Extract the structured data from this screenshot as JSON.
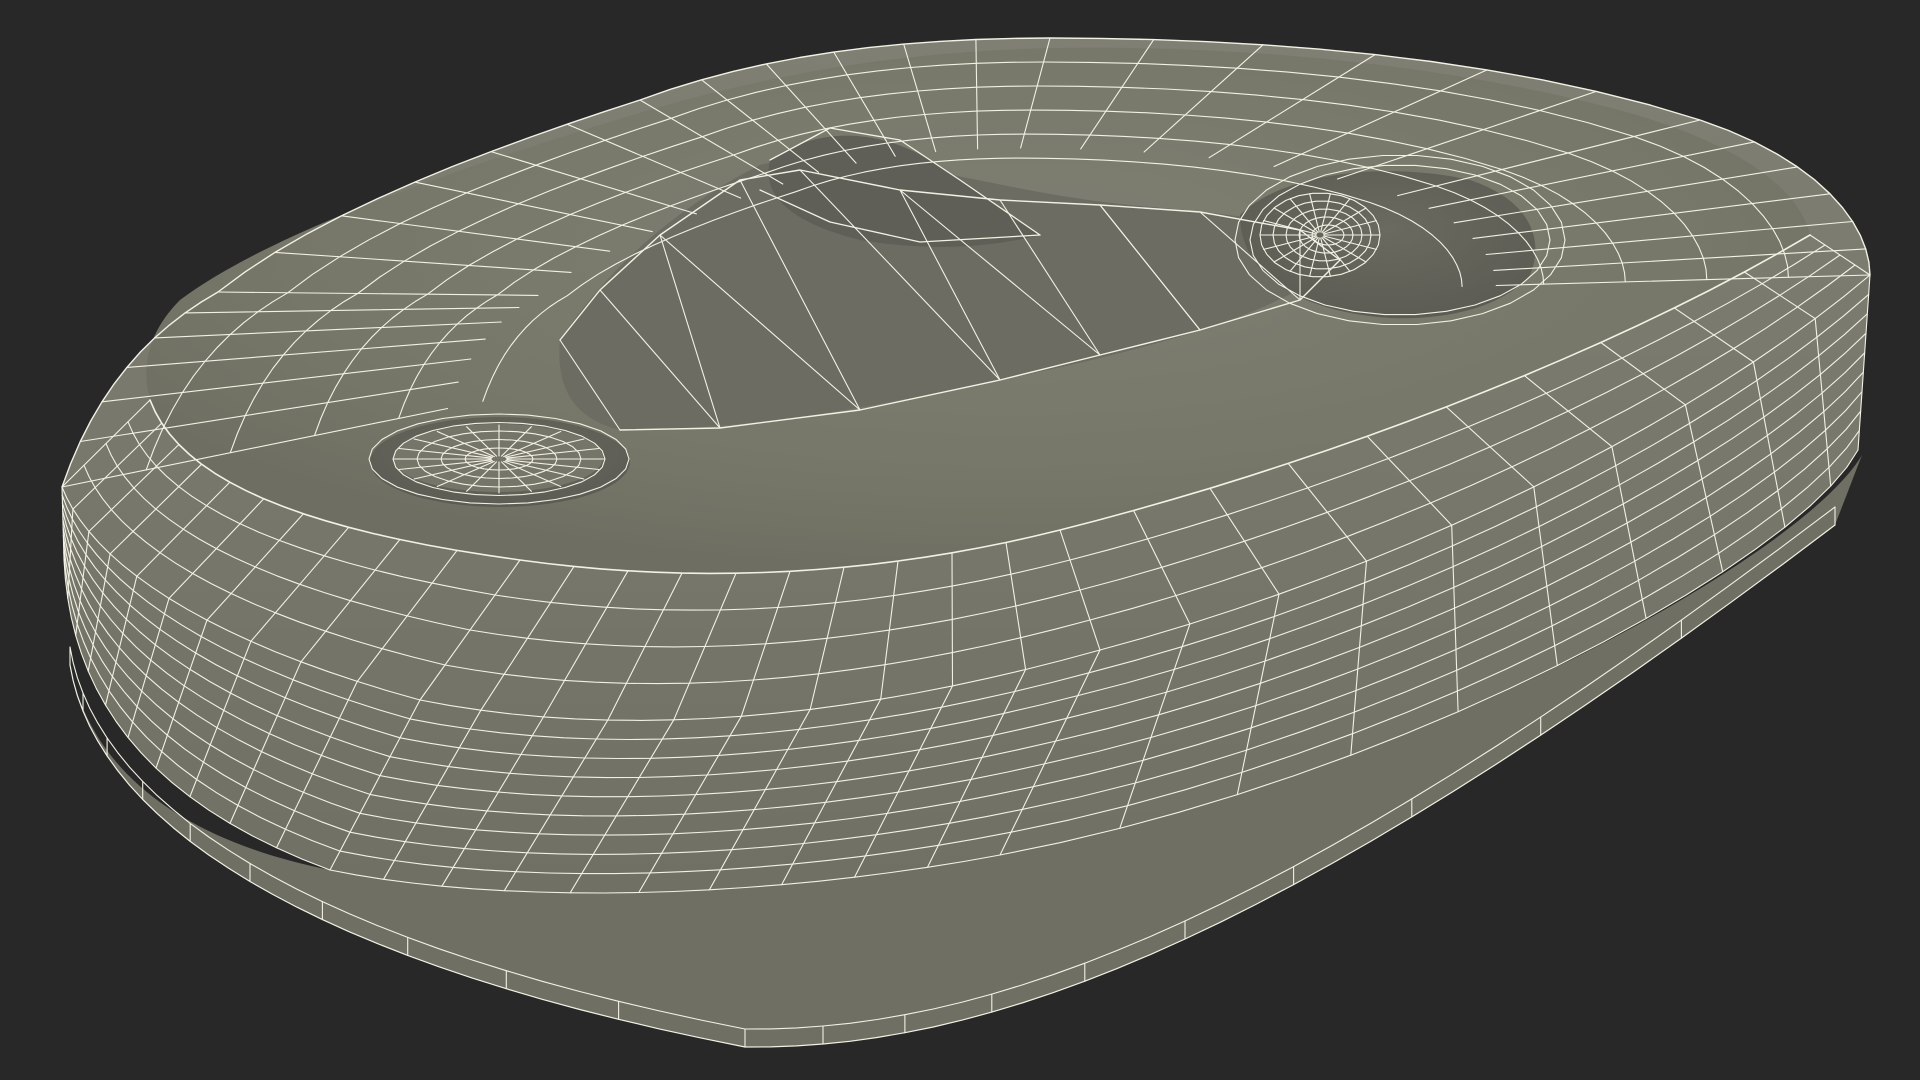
{
  "scene": {
    "subject": "wireframe-3d-model",
    "colors": {
      "background": "#282828",
      "surface": "#7c7c70",
      "surface_shadow": "#62625a",
      "surface_light": "#8a8a7e",
      "wire": "#f2f1e4"
    }
  }
}
